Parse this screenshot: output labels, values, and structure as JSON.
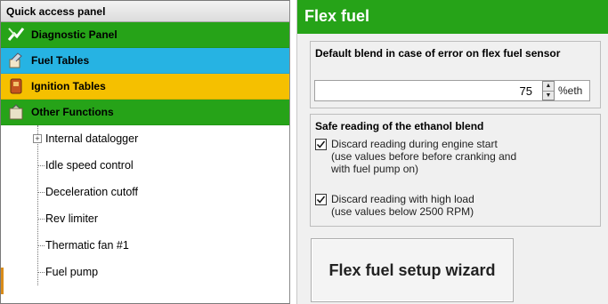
{
  "quick_access": {
    "title": "Quick access panel",
    "categories": [
      {
        "label": "Diagnostic Panel",
        "icon": "diagnostic-icon",
        "color": "#26a318"
      },
      {
        "label": "Fuel Tables",
        "icon": "fuel-icon",
        "color": "#26b3e3"
      },
      {
        "label": "Ignition Tables",
        "icon": "ignition-icon",
        "color": "#f5c000"
      },
      {
        "label": "Other Functions",
        "icon": "other-functions-icon",
        "color": "#26a318"
      }
    ],
    "tree_items": [
      {
        "label": "Internal datalogger",
        "expandable": true
      },
      {
        "label": "Idle speed control"
      },
      {
        "label": "Deceleration cutoff"
      },
      {
        "label": "Rev limiter"
      },
      {
        "label": "Thermatic fan #1"
      },
      {
        "label": "Fuel pump"
      }
    ]
  },
  "flex_fuel": {
    "title": "Flex fuel",
    "default_blend": {
      "label": "Default blend in case of error on flex fuel sensor",
      "value": "75",
      "unit": "%eth"
    },
    "safe_reading": {
      "label": "Safe reading of the ethanol blend",
      "options": [
        {
          "label": "Discard reading during engine start",
          "detail1": "(use values before before cranking and",
          "detail2": "with fuel pump on)",
          "checked": true
        },
        {
          "label": "Discard reading with high load",
          "detail1": "(use values below 2500 RPM)",
          "checked": true
        }
      ]
    },
    "wizard_button": "Flex fuel setup wizard"
  }
}
